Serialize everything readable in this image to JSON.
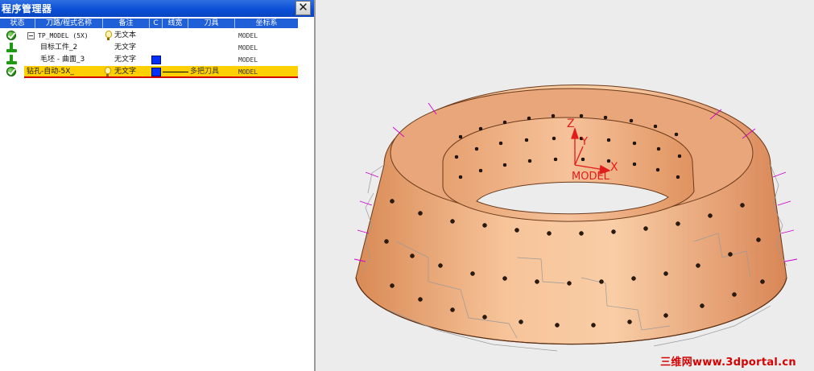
{
  "window": {
    "title": "程序管理器",
    "close_glyph": "✕"
  },
  "columns": [
    "状态",
    "刀路/程式名称",
    "备注",
    "C",
    "线宽",
    "刀具",
    "坐标系"
  ],
  "rows": [
    {
      "name": "TP_MODEL (5X)",
      "note": "无文本",
      "coord": "MODEL",
      "status": "ok",
      "expand": true,
      "bulb": true
    },
    {
      "name": "目标工件_2",
      "note": "无文字",
      "coord": "MODEL",
      "status": "stock"
    },
    {
      "name": "毛坯 - 曲面_3",
      "note": "无文字",
      "coord": "MODEL",
      "status": "stock",
      "color": "#0030ff"
    },
    {
      "name": "钻孔-自动-5X_",
      "note": "无文字",
      "coord": "MODEL",
      "status": "ok",
      "bulb": true,
      "color": "#0030ff",
      "tool": "多把刀具",
      "selected": true
    }
  ],
  "axes": {
    "z": "Z",
    "y": "Y",
    "x": "X",
    "label": "MODEL"
  },
  "watermark": "三维网www.3dportal.cn",
  "colors": {
    "part": "#f2b98a",
    "axis": "#e21b1b",
    "selection": "#ffd000",
    "header": "#1f5fd8"
  }
}
